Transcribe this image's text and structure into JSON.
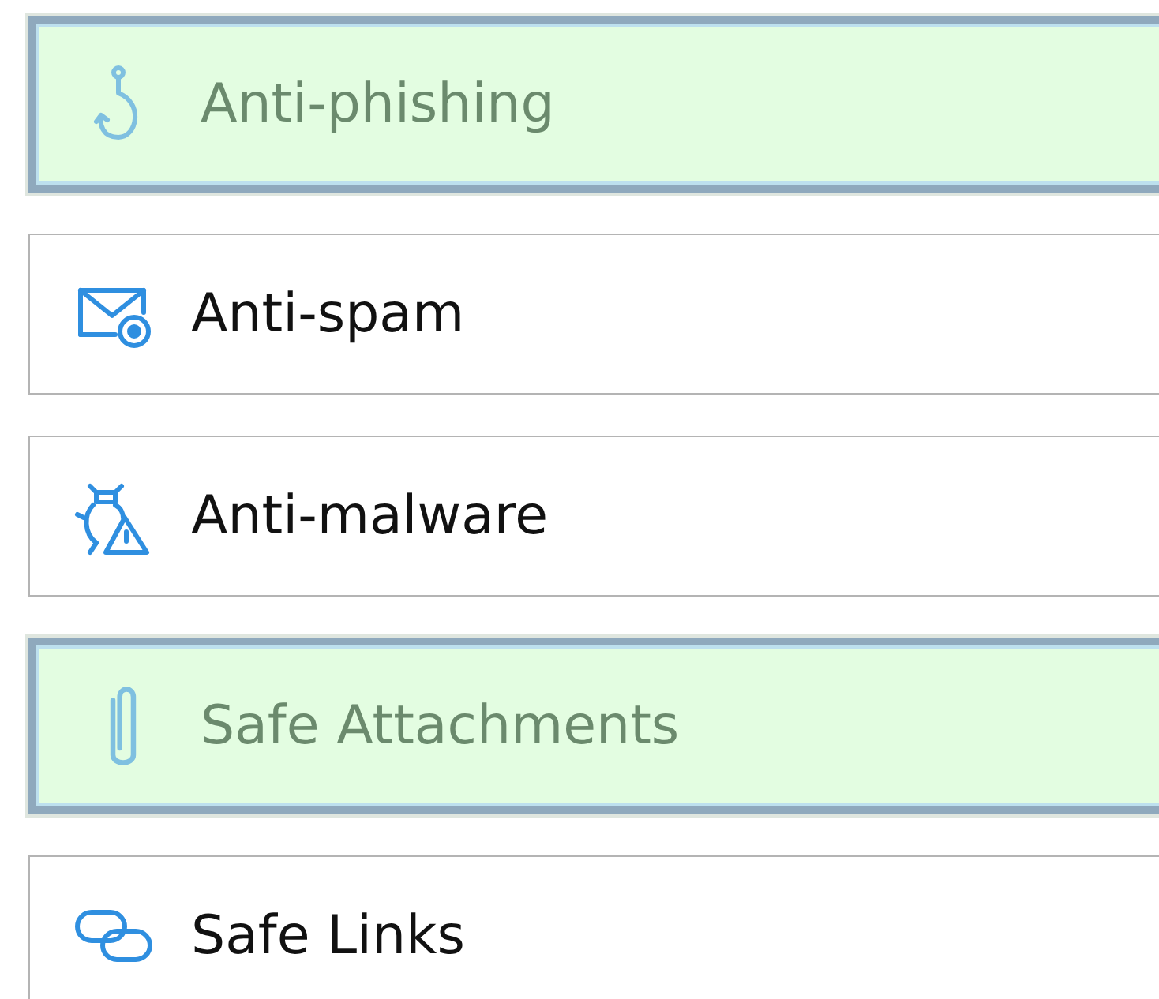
{
  "policies": [
    {
      "label": "Anti-phishing",
      "selected": true
    },
    {
      "label": "Anti-spam",
      "selected": false
    },
    {
      "label": "Anti-malware",
      "selected": false
    },
    {
      "label": "Safe Attachments",
      "selected": true
    },
    {
      "label": "Safe Links",
      "selected": false
    }
  ]
}
